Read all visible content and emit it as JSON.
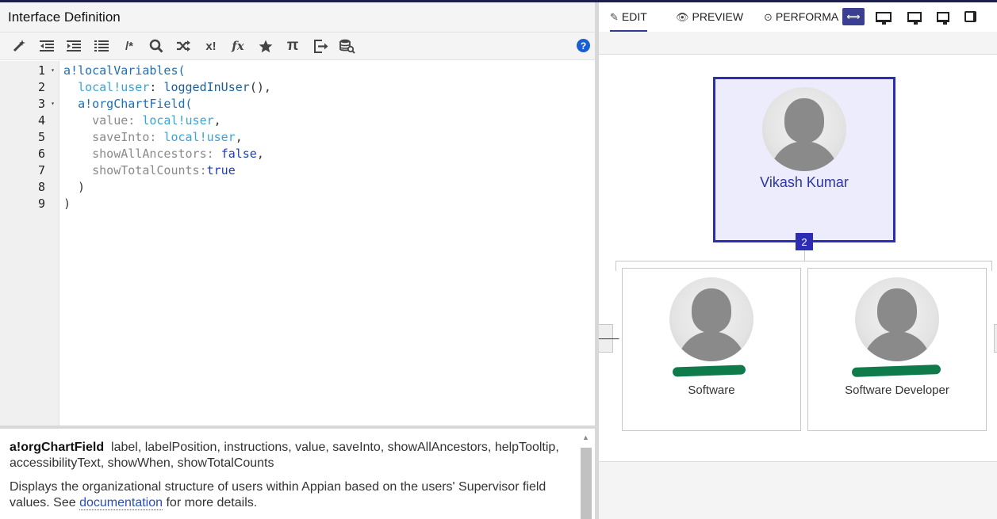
{
  "left": {
    "title": "Interface Definition",
    "toolbar": {
      "icons": [
        "magic-wand-icon",
        "outdent-icon",
        "indent-icon",
        "format-icon",
        "comment-icon",
        "search-icon",
        "shuffle-icon",
        "expression-icon",
        "function-icon",
        "star-icon",
        "pi-icon",
        "export-icon",
        "database-search-icon",
        "help-icon"
      ],
      "comment_glyph": "/*",
      "expr_glyph": "x!",
      "fn_glyph": "fx",
      "pi_glyph": "π",
      "help_glyph": "?"
    },
    "editor": {
      "line_numbers": [
        "1",
        "2",
        "3",
        "4",
        "5",
        "6",
        "7",
        "8",
        "9"
      ],
      "fold_markers": [
        "▾",
        "",
        "▾",
        "",
        "",
        "",
        "",
        "",
        ""
      ],
      "lines": [
        {
          "segments": [
            {
              "t": "a!localVariables",
              "c": "c-fn"
            },
            {
              "t": "(",
              "c": "c-fn"
            }
          ]
        },
        {
          "segments": [
            {
              "t": "  ",
              "c": "c-punc"
            },
            {
              "t": "local!user",
              "c": "c-var"
            },
            {
              "t": ": ",
              "c": "c-punc"
            },
            {
              "t": "loggedInUser",
              "c": "c-fn2"
            },
            {
              "t": "(),",
              "c": "c-punc"
            }
          ]
        },
        {
          "segments": [
            {
              "t": "  ",
              "c": "c-punc"
            },
            {
              "t": "a!orgChartField",
              "c": "c-fn"
            },
            {
              "t": "(",
              "c": "c-fn"
            }
          ]
        },
        {
          "segments": [
            {
              "t": "    ",
              "c": "c-punc"
            },
            {
              "t": "value",
              "c": "c-key"
            },
            {
              "t": ": ",
              "c": "c-key"
            },
            {
              "t": "local!user",
              "c": "c-var"
            },
            {
              "t": ",",
              "c": "c-punc"
            }
          ]
        },
        {
          "segments": [
            {
              "t": "    ",
              "c": "c-punc"
            },
            {
              "t": "saveInto",
              "c": "c-key"
            },
            {
              "t": ": ",
              "c": "c-key"
            },
            {
              "t": "local!user",
              "c": "c-var"
            },
            {
              "t": ",",
              "c": "c-punc"
            }
          ]
        },
        {
          "segments": [
            {
              "t": "    ",
              "c": "c-punc"
            },
            {
              "t": "showAllAncestors",
              "c": "c-key"
            },
            {
              "t": ": ",
              "c": "c-key"
            },
            {
              "t": "false",
              "c": "c-kw"
            },
            {
              "t": ",",
              "c": "c-punc"
            }
          ]
        },
        {
          "segments": [
            {
              "t": "    ",
              "c": "c-punc"
            },
            {
              "t": "showTotalCounts",
              "c": "c-key"
            },
            {
              "t": ":",
              "c": "c-key"
            },
            {
              "t": "true",
              "c": "c-kw"
            }
          ]
        },
        {
          "segments": [
            {
              "t": "  )",
              "c": "c-punc"
            }
          ]
        },
        {
          "segments": [
            {
              "t": ")",
              "c": "c-punc"
            }
          ]
        }
      ]
    },
    "doc": {
      "function_name": "a!orgChartField",
      "params": "label, labelPosition, instructions, value, saveInto, showAllAncestors, helpTooltip, accessibilityText, showWhen, showTotalCounts",
      "desc_before": "Displays the organizational structure of users within Appian based on the users' Supervisor field values. See ",
      "link_text": "documentation",
      "desc_after": " for more details."
    }
  },
  "right": {
    "tabs": {
      "edit": "EDIT",
      "preview": "PREVIEW",
      "performance": "PERFORMA"
    },
    "tab_icons": {
      "edit": "✎",
      "preview": "👁",
      "performance": "⊙"
    },
    "view_buttons": [
      "fit-width-icon",
      "desktop-icon",
      "monitor-icon",
      "tablet-icon",
      "phone-icon"
    ],
    "fit_glyph": "⟺",
    "org_chart": {
      "root": {
        "name": "Vikash Kumar",
        "count": "2"
      },
      "children": [
        {
          "name_redacted": true,
          "title": "Software"
        },
        {
          "name_redacted": true,
          "title": "Software Developer"
        }
      ],
      "collapse_glyph": "🡐"
    }
  },
  "colors": {
    "accent": "#2c2cb5",
    "selected_bg": "#ececfc",
    "help_blue": "#1a5fd0",
    "redaction": "#0f7a4a"
  }
}
